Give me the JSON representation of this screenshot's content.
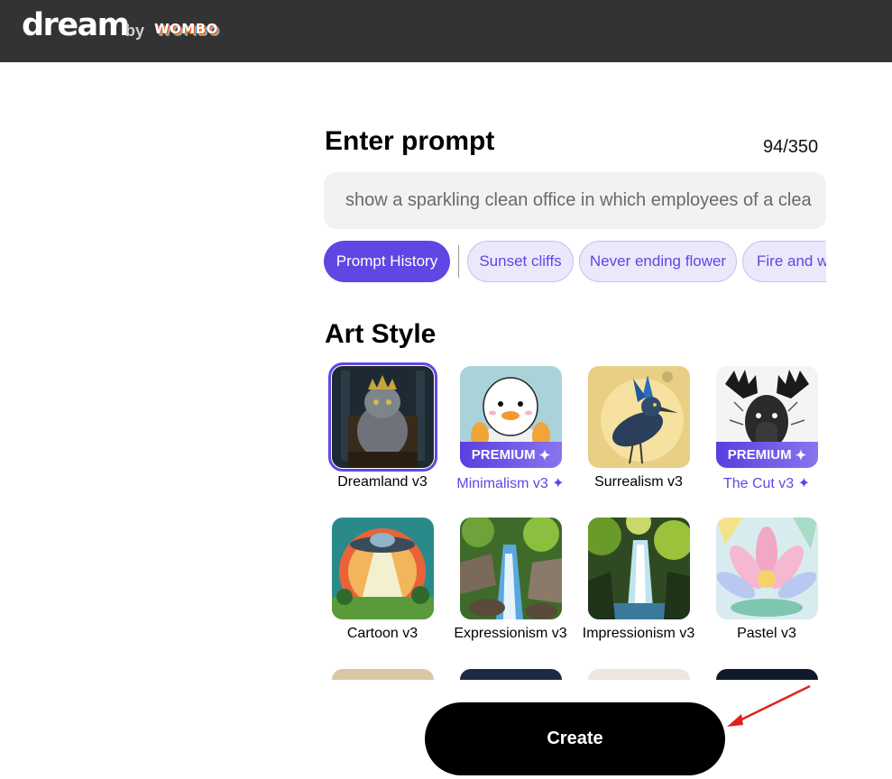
{
  "header": {
    "logo_text": "dream",
    "by_text": "by",
    "brand_text": "WOMBO"
  },
  "prompt": {
    "title": "Enter prompt",
    "counter": "94/350",
    "value": "show a sparkling clean office in which employees of a clea"
  },
  "chips": {
    "history_label": "Prompt History",
    "suggestions": [
      "Sunset cliffs",
      "Never ending flower",
      "Fire and wa"
    ]
  },
  "art_style": {
    "title": "Art Style",
    "premium_badge": "PREMIUM",
    "sparkle": "✦",
    "items": [
      {
        "label": "Dreamland v3",
        "premium": false,
        "selected": true
      },
      {
        "label": "Minimalism v3 ✦",
        "premium": true,
        "selected": false
      },
      {
        "label": "Surrealism v3",
        "premium": false,
        "selected": false
      },
      {
        "label": "The Cut v3 ✦",
        "premium": true,
        "selected": false
      },
      {
        "label": "Cartoon v3",
        "premium": false,
        "selected": false
      },
      {
        "label": "Expressionism v3",
        "premium": false,
        "selected": false
      },
      {
        "label": "Impressionism v3",
        "premium": false,
        "selected": false
      },
      {
        "label": "Pastel v3",
        "premium": false,
        "selected": false
      }
    ]
  },
  "actions": {
    "create_label": "Create"
  },
  "colors": {
    "accent": "#5f47e4",
    "topbar": "#333333",
    "annotation_arrow": "#e0211d"
  }
}
